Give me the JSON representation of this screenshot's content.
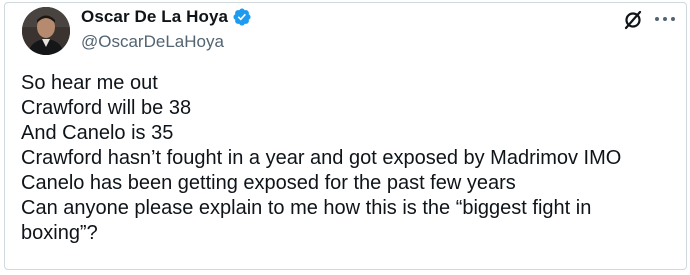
{
  "author": {
    "display_name": "Oscar De La Hoya",
    "handle": "@OscarDeLaHoya",
    "verified_icon": "verified-badge-icon",
    "avatar_icon": "profile-photo"
  },
  "actions": {
    "grok_icon": "grok-icon",
    "more_icon": "more-horizontal-icon"
  },
  "tweet": {
    "lines": [
      "So hear me out",
      "Crawford will be 38",
      "And Canelo is 35",
      "Crawford hasn’t fought in a year and got exposed by Madrimov IMO",
      "Canelo has been getting exposed for the past few years",
      "Can anyone please explain to me how this is the “biggest fight in",
      "boxing”?"
    ]
  },
  "colors": {
    "text": "#0f1419",
    "secondary_text": "#536471",
    "verified": "#1d9bf0",
    "border": "#cfd9de"
  }
}
